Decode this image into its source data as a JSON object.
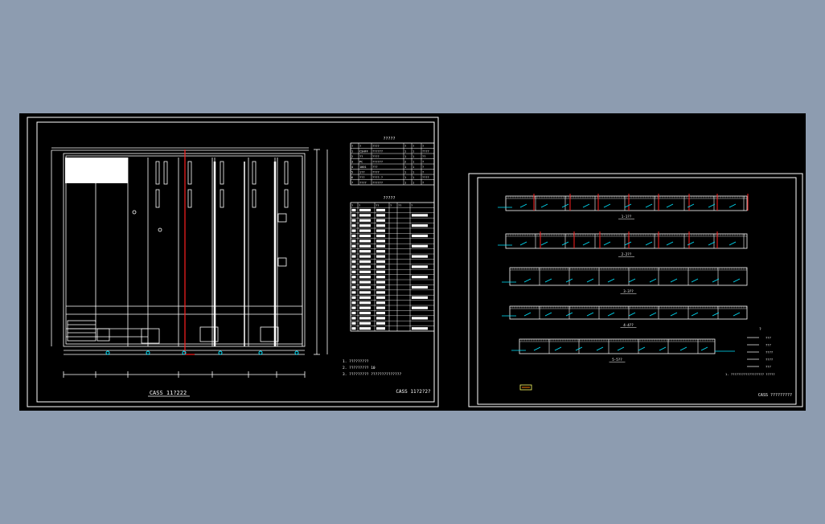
{
  "sheet_left": {
    "plan_title": "CASS 11?222",
    "drawing_title": "CASS 11?2?2?",
    "notes": [
      "1. ?????????",
      "2. ????????? 10",
      "3. ????????? ??????????????"
    ],
    "table1": {
      "title": "?????",
      "header": [
        "?",
        "?",
        "????",
        "?",
        "?",
        "?"
      ],
      "rows": [
        [
          "1",
          "CSHFF",
          "??????",
          "1",
          "1",
          "????"
        ],
        [
          "2",
          "??",
          "????",
          "1",
          "1",
          "??"
        ],
        [
          "3",
          "PC",
          "??????",
          "2",
          "1",
          "?"
        ],
        [
          "4",
          "1001",
          "???",
          "1",
          "1",
          "?"
        ],
        [
          "5",
          "1??",
          "????",
          "1",
          "1",
          "?"
        ],
        [
          "6",
          "???",
          "????.?",
          "1",
          "1",
          "????"
        ],
        [
          "7",
          "????",
          "??????",
          "1",
          "1",
          "?"
        ]
      ]
    },
    "table2": {
      "title": "?????",
      "header": [
        "?",
        "?",
        "??",
        "?",
        "??",
        "?"
      ],
      "row_count": 24
    }
  },
  "sheet_right": {
    "drawing_title": "CASS ?????????",
    "section_labels": [
      "1-1??",
      "2-2??",
      "3-3??",
      "4-4??",
      "5-5??"
    ],
    "legend_title": "?",
    "legend_items": [
      "???",
      "???",
      "????",
      "????",
      "???"
    ],
    "notes": "1. ??????????????????    ?????"
  },
  "colors": {
    "background": "#000000",
    "outside": "#8d9cb0",
    "frame": "#ffffff",
    "pipe": "#ff2020",
    "annotation": "#00e5ff",
    "wall": "#ffffff"
  }
}
